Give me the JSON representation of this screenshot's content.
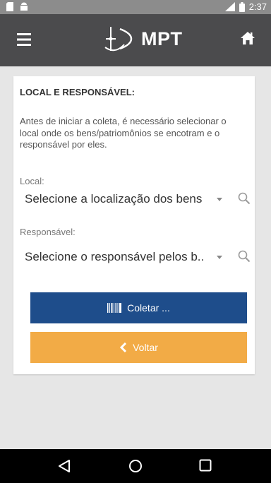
{
  "status_bar": {
    "time": "2:37",
    "left_icons": [
      "sd-card-icon",
      "android-icon"
    ],
    "right_icons": [
      "signal-icon",
      "battery-icon"
    ]
  },
  "app_bar": {
    "title": "MPT",
    "menu_icon": "hamburger-menu-icon",
    "home_icon": "home-icon",
    "background": "#4b4b4d"
  },
  "form": {
    "section_title": "LOCAL E RESPONSÁVEL:",
    "intro_lines": [
      "Antes de iniciar a coleta, é necessário selecionar o",
      "local onde os bens/patriomônios se encotram e o",
      "responsável por eles."
    ],
    "local": {
      "label": "Local:",
      "value": "Selecione a localização dos bens"
    },
    "responsavel": {
      "label": "Responsável:",
      "value": "Selecione o responsável pelos b.."
    }
  },
  "buttons": {
    "collect": {
      "label": "Coletar ...",
      "icon": "barcode-icon",
      "color": "#1e4d8b"
    },
    "back": {
      "label": "Voltar",
      "icon": "chevron-left-icon",
      "color": "#f2ab46"
    }
  },
  "nav_bar": {
    "buttons": [
      "back-triangle-icon",
      "home-circle-icon",
      "recents-square-icon"
    ]
  }
}
